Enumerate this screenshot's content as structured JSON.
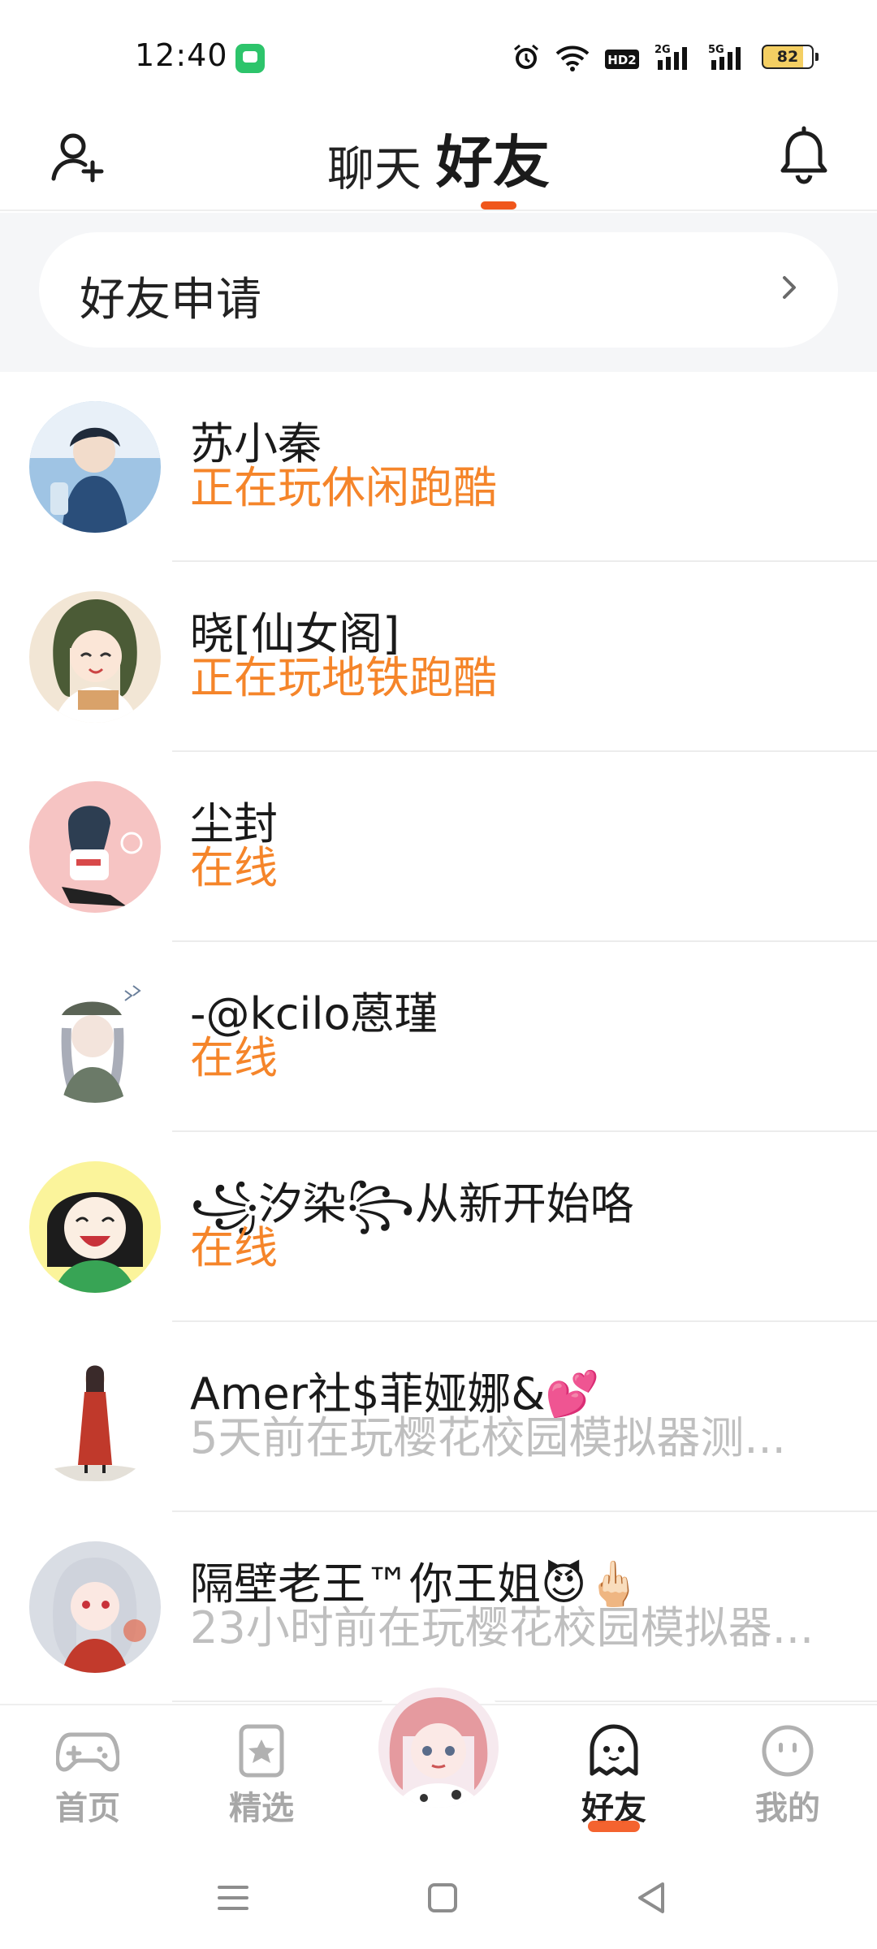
{
  "status_bar": {
    "time": "12:40",
    "battery": "82",
    "network_labels": [
      "HD2",
      "2G",
      "5G"
    ]
  },
  "header": {
    "tabs": [
      {
        "label": "聊天",
        "active": false
      },
      {
        "label": "好友",
        "active": true
      }
    ],
    "accent_color": "#f0561b"
  },
  "friend_request": {
    "label": "好友申请"
  },
  "friends": [
    {
      "name": "苏小秦",
      "status": "正在玩休闲跑酷",
      "online": true,
      "avatar_colors": [
        "#2a4e7a",
        "#9fc4e4"
      ]
    },
    {
      "name": "晓[仙女阁]",
      "status": "正在玩地铁跑酷",
      "online": true,
      "avatar_colors": [
        "#4b5b36",
        "#f2e6d5"
      ]
    },
    {
      "name": "尘封",
      "status": "在线",
      "online": true,
      "avatar_colors": [
        "#f6c4c3",
        "#3c3c3c"
      ]
    },
    {
      "name": "-@kcilo蒽瑾",
      "status": "在线",
      "online": true,
      "avatar_colors": [
        "#e9ecea",
        "#6b7a68"
      ]
    },
    {
      "name": "꧁汐染꧂从新开始咯",
      "status": "在线",
      "online": true,
      "avatar_colors": [
        "#fbf49b",
        "#2c2c2c"
      ]
    },
    {
      "name": "Amer社$菲娅娜&💕",
      "status": "5天前在玩樱花校园模拟器测...",
      "online": false,
      "avatar_colors": [
        "#ffffff",
        "#c0392b"
      ]
    },
    {
      "name": "隔壁老王™你王姐😈🖕🏻",
      "status": "23小时前在玩樱花校园模拟器...",
      "online": false,
      "avatar_colors": [
        "#d9dde4",
        "#c23a2c"
      ]
    }
  ],
  "bottom_nav": {
    "items": [
      {
        "label": "首页",
        "icon": "gamepad-icon",
        "active": false
      },
      {
        "label": "精选",
        "icon": "star-bookmark-icon",
        "active": false
      },
      {
        "label": "好友",
        "icon": "ghost-icon",
        "active": true
      },
      {
        "label": "我的",
        "icon": "smiley-icon",
        "active": false
      }
    ]
  },
  "colors": {
    "online_status": "#f5852a",
    "offline_status": "#bfbfbf",
    "accent": "#f0561b"
  }
}
